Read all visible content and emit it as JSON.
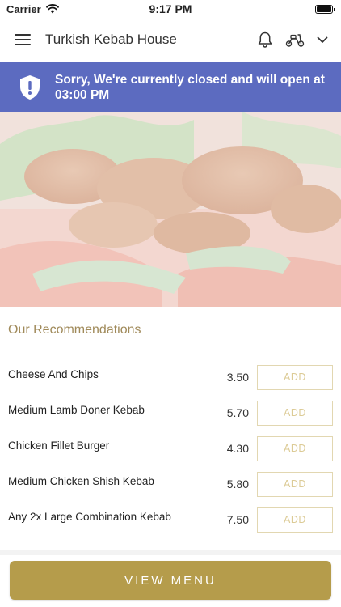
{
  "status_bar": {
    "carrier": "Carrier",
    "time": "9:17 PM",
    "battery_level": 1.0
  },
  "header": {
    "title": "Turkish Kebab House",
    "icons": [
      "menu-icon",
      "bell-icon",
      "scooter-icon",
      "chevron-down-icon"
    ]
  },
  "banner": {
    "icon": "shield-alert-icon",
    "message": "Sorry, We're currently closed and will open at 03:00 PM",
    "color": "#5c6bc0"
  },
  "hero": {
    "description_icon": "food-photo"
  },
  "recommendations": {
    "title": "Our Recommendations",
    "items": [
      {
        "name": "Cheese And Chips",
        "price": "3.50",
        "action": "ADD"
      },
      {
        "name": "Medium Lamb Doner Kebab",
        "price": "5.70",
        "action": "ADD"
      },
      {
        "name": "Chicken Fillet Burger",
        "price": "4.30",
        "action": "ADD"
      },
      {
        "name": "Medium Chicken Shish Kebab",
        "price": "5.80",
        "action": "ADD"
      },
      {
        "name": "Any 2x Large Combination Kebab",
        "price": "7.50",
        "action": "ADD"
      }
    ]
  },
  "footer": {
    "view_menu_label": "VIEW MENU",
    "accent_color": "#b59c4b"
  }
}
